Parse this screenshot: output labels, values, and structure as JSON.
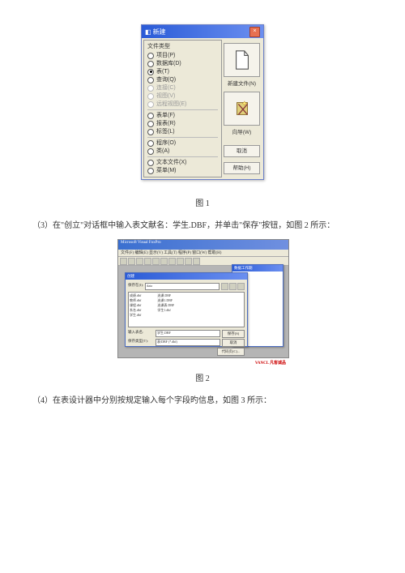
{
  "dialog1": {
    "title": "新建",
    "panel_label": "文件类型",
    "options": [
      "项目(P)",
      "数据库(D)",
      "表(T)",
      "查询(Q)",
      "连接(C)",
      "视图(V)",
      "远程视图(E)",
      "表单(F)",
      "报表(R)",
      "标签(L)",
      "程序(O)",
      "类(A)",
      "文本文件(X)",
      "菜单(M)"
    ],
    "selected_index": 2,
    "disabled_indices": [
      4,
      5,
      6
    ],
    "new_file_btn": "新建文件(N)",
    "wizard_btn": "向导(W)",
    "cancel_btn": "取消",
    "help_btn": "帮助(H)"
  },
  "caption1": "图 1",
  "paragraph3": "（3）在\"创立\"对话框中输入表文献名：学生.DBF，并单击\"保存\"按钮，如图 2 所示：",
  "screenshot2": {
    "app_title": "Microsoft Visual FoxPro",
    "menubar": "文件(F) 编辑(E) 显示(V) 工具(T) 程序(P) 窗口(W) 帮助(H)",
    "create_dialog": {
      "title": "创建",
      "field_label1": "保存在(I):",
      "folder": "data",
      "items_col1": [
        "成绩.dbf",
        "教师.dbf",
        "课程.dbf",
        "系名.dbf",
        "学生.dbf"
      ],
      "items_col2": [
        "选课.DBF",
        "选课1.DBF",
        "选课表.DBF",
        "学生1.dbf"
      ],
      "filename_label": "输入表名:",
      "filename_value": "学生.DBF",
      "type_label": "保存类型(T):",
      "type_value": "表/DBF (*.dbf)",
      "save_btn": "保存(S)",
      "cancel_btn": "取消",
      "codepage": "代码页(C)..."
    },
    "data_window_title": "数据工作期",
    "watermark": "VANCL 凡客诚品"
  },
  "caption2": "图 2",
  "paragraph4": "（4）在表设计器中分别按规定输入每个字段旳信息，如图 3 所示："
}
